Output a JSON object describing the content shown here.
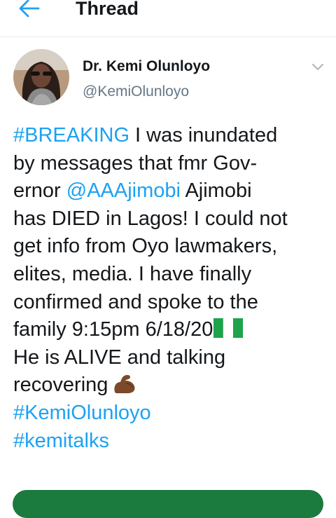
{
  "header": {
    "title": "Thread",
    "back_icon": "arrow-left-icon",
    "accent": "#1da1f2"
  },
  "tweet": {
    "display_name": "Dr. Kemi Olunloyo",
    "handle": "@KemiOlunloyo",
    "body": {
      "breaking_tag": "#BREAKING",
      "l1_rest": " I was inundated",
      "l2": "by messages that fmr Gov-",
      "l3_pre": "ernor ",
      "mention": "@AAAjimobi",
      "l3_post": " Ajimobi",
      "l4": "has DIED in Lagos! I could not",
      "l5": "get info from Oyo lawmakers,",
      "l6": "elites, media. I have finally",
      "l7": "confirmed and spoke to the",
      "l8": "family 9:15pm 6/18/20",
      "l9": "He is ALIVE and talking",
      "l10": "recovering",
      "tag2": "#KemiOlunloyo",
      "tag3": "#kemitalks"
    },
    "icons": {
      "flag": "nigeria-flag-emoji",
      "muscle": "flexed-biceps-emoji",
      "caret": "chevron-down-icon"
    }
  },
  "colors": {
    "link": "#1da1f2",
    "text": "#14171a",
    "muted": "#657786",
    "bottom_bar": "#1b7a3e"
  }
}
